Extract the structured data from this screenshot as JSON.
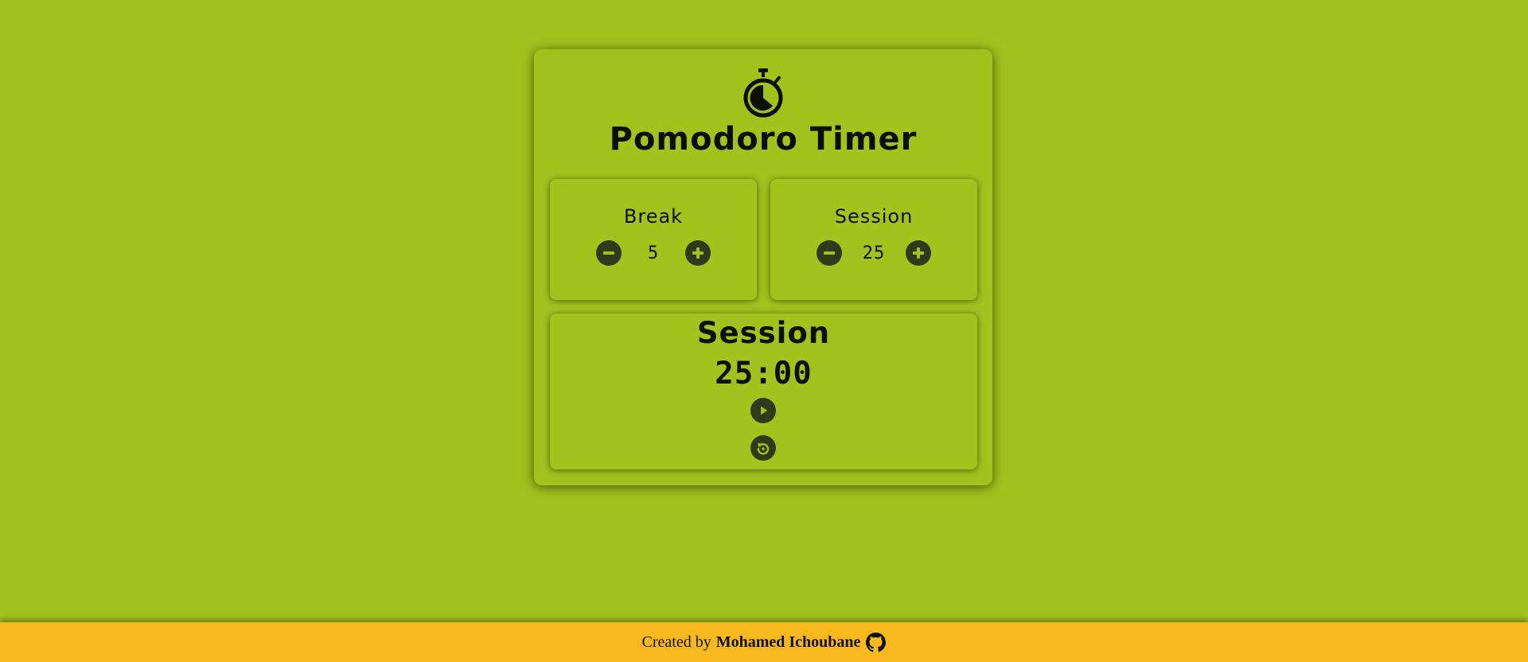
{
  "app": {
    "title": "Pomodoro Timer",
    "logo_icon": "stopwatch-icon"
  },
  "break": {
    "label": "Break",
    "length": "5",
    "decrement_icon": "minus-circle-icon",
    "increment_icon": "plus-circle-icon"
  },
  "session": {
    "label": "Session",
    "length": "25",
    "decrement_icon": "minus-circle-icon",
    "increment_icon": "plus-circle-icon"
  },
  "timer": {
    "label": "Session",
    "time_left": "25:00",
    "play_icon": "play-icon",
    "reset_icon": "reset-icon"
  },
  "footer": {
    "prefix": "Created by",
    "author": "Mohamed Ichoubane",
    "link_icon": "github-icon"
  },
  "colors": {
    "background": "#a2c21e",
    "footer": "#f8b91e",
    "text": "#0c0e00",
    "button": "#2e3a1a"
  }
}
